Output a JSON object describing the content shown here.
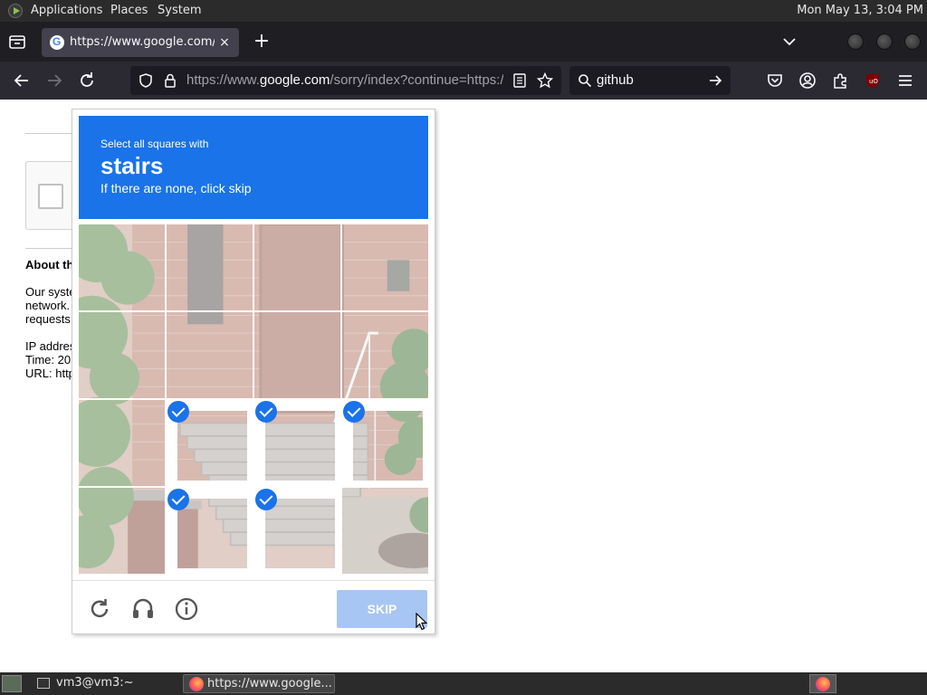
{
  "top_panel": {
    "menus": [
      "Applications",
      "Places",
      "System"
    ],
    "clock": "Mon May 13,  3:04 PM"
  },
  "browser": {
    "tab": {
      "title": "https://www.google.com/sorry/index",
      "close_glyph": "×"
    },
    "new_tab_glyph": "+",
    "url_prefix": "https://www.",
    "url_domain": "google.com",
    "url_rest": "/sorry/index?continue=https://www.google.com",
    "search_query": "github"
  },
  "page": {
    "about_heading": "About th",
    "paragraph": "Our syste\nnetwork.\nrequests",
    "info": "IP addres\nTime: 20\nURL: http"
  },
  "captcha": {
    "instruction_pre": "Select all squares with",
    "object": "stairs",
    "instruction_post": "If there are none, click skip",
    "tiles_selected": [
      false,
      false,
      false,
      false,
      false,
      false,
      false,
      false,
      false,
      true,
      true,
      true,
      false,
      true,
      true,
      false
    ],
    "skip_label": "SKIP",
    "icons": [
      "reload-icon",
      "audio-icon",
      "info-icon"
    ]
  },
  "taskbar": {
    "tasks": [
      {
        "label": "vm3@vm3:~",
        "icon": "terminal-icon"
      },
      {
        "label": "https://www.google...",
        "icon": "firefox-icon"
      }
    ]
  },
  "colors": {
    "captcha_blue": "#1a73e8",
    "skip_disabled": "#a7c6f3"
  }
}
